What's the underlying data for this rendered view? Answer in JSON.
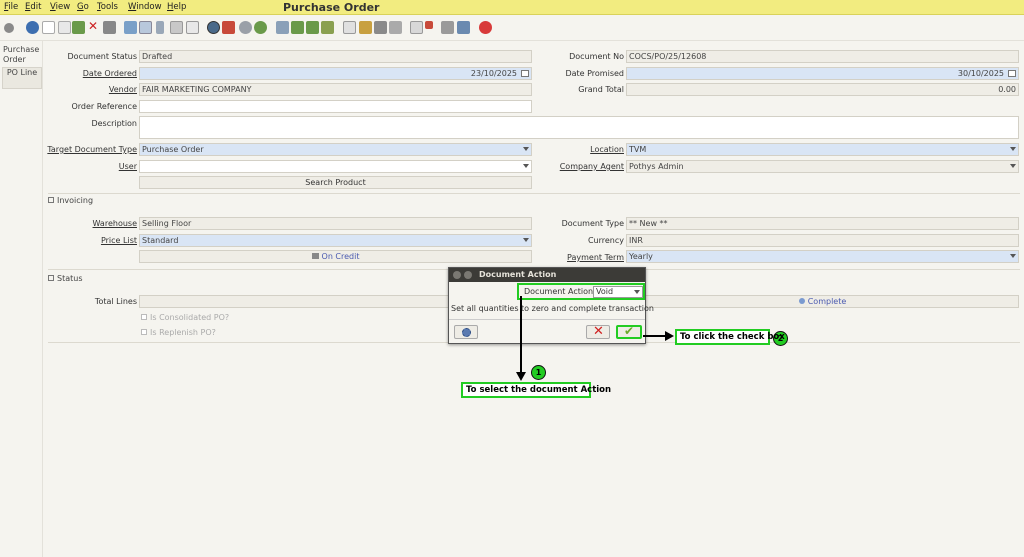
{
  "app_title": "Purchase Order",
  "menu": [
    {
      "accel": "F",
      "rest": "ile"
    },
    {
      "accel": "E",
      "rest": "dit"
    },
    {
      "accel": "V",
      "rest": "iew"
    },
    {
      "accel": "G",
      "rest": "o"
    },
    {
      "accel": "T",
      "rest": "ools"
    },
    {
      "accel": "W",
      "rest": "indow"
    },
    {
      "accel": "H",
      "rest": "elp"
    }
  ],
  "left_tabs": {
    "purchase_order": "Purchase Order",
    "po_line": "PO Line"
  },
  "form": {
    "document_status": {
      "label": "Document Status",
      "value": "Drafted"
    },
    "document_no": {
      "label": "Document No",
      "value": "COCS/PO/25/12608"
    },
    "date_ordered": {
      "label": "Date Ordered",
      "value": "23/10/2025"
    },
    "date_promised": {
      "label": "Date Promised",
      "value": "30/10/2025"
    },
    "vendor": {
      "label": "Vendor",
      "value": "FAIR MARKETING COMPANY"
    },
    "grand_total": {
      "label": "Grand Total",
      "value": "0.00"
    },
    "order_reference": {
      "label": "Order Reference",
      "value": ""
    },
    "description": {
      "label": "Description",
      "value": ""
    },
    "target_document_type": {
      "label": "Target Document Type",
      "value": "Purchase Order"
    },
    "location": {
      "label": "Location",
      "value": "TVM"
    },
    "user": {
      "label": "User",
      "value": ""
    },
    "company_agent": {
      "label": "Company Agent",
      "value": "Pothys Admin"
    },
    "search_product": "Search Product"
  },
  "invoicing": {
    "header": "Invoicing",
    "warehouse": {
      "label": "Warehouse",
      "value": "Selling Floor"
    },
    "document_type": {
      "label": "Document Type",
      "value": "** New **"
    },
    "price_list": {
      "label": "Price List",
      "value": "Standard"
    },
    "currency": {
      "label": "Currency",
      "value": "INR"
    },
    "on_credit": "On Credit",
    "payment_term": {
      "label": "Payment Term",
      "value": "Yearly"
    }
  },
  "status": {
    "header": "Status",
    "total_lines": {
      "label": "Total Lines",
      "value": ""
    },
    "complete_button": "Complete",
    "is_consolidated": "Is Consolidated PO?",
    "is_replenish": "Is Replenish PO?"
  },
  "dialog": {
    "title": "Document Action",
    "action_label": "Document Action",
    "action_value": "Void",
    "description": "Set all quantities to zero and complete transaction"
  },
  "annotations": {
    "step1_number": "1",
    "step1_text": "To select the document Action",
    "step2_number": "2",
    "step2_text": "To click the check box"
  },
  "colors": {
    "menubar": "#f2ec80",
    "highlight": "#22cc22",
    "blue_field": "#d9e5f5",
    "dialog_title": "#3c3b37"
  }
}
